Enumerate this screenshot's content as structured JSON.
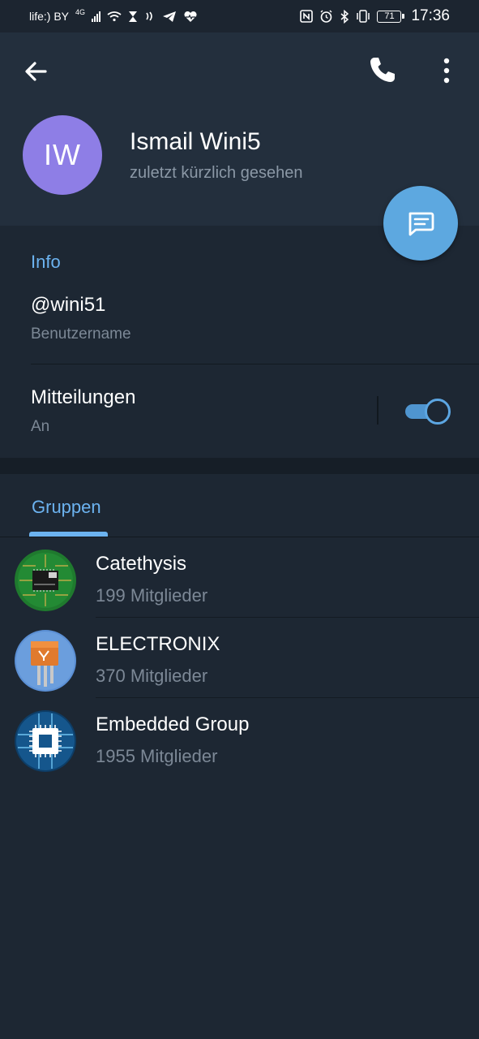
{
  "status_bar": {
    "carrier": "life:) BY",
    "network": "4G",
    "battery": "71",
    "time": "17:36"
  },
  "header": {
    "avatar_initials": "IW",
    "avatar_color": "#8e7ee6",
    "name": "Ismail Wini5",
    "status": "zuletzt kürzlich gesehen",
    "icons": [
      "back-arrow-icon",
      "phone-icon",
      "more-vertical-icon",
      "message-icon"
    ]
  },
  "info": {
    "section_title": "Info",
    "username": "@wini51",
    "username_label": "Benutzername",
    "notifications_title": "Mitteilungen",
    "notifications_value": "An",
    "notifications_enabled": true
  },
  "groups": {
    "tab_label": "Gruppen",
    "items": [
      {
        "name": "Catethysis",
        "members": "199 Mitglieder",
        "avatar_icon": "circuit-board-icon"
      },
      {
        "name": "ELECTRONIX",
        "members": "370 Mitglieder",
        "avatar_icon": "transistor-icon"
      },
      {
        "name": "Embedded Group",
        "members": "1955 Mitglieder",
        "avatar_icon": "chip-icon"
      }
    ]
  },
  "colors": {
    "accent": "#6cb3f0",
    "fab": "#5da8e0",
    "background": "#1d2733",
    "header": "#232f3d"
  }
}
